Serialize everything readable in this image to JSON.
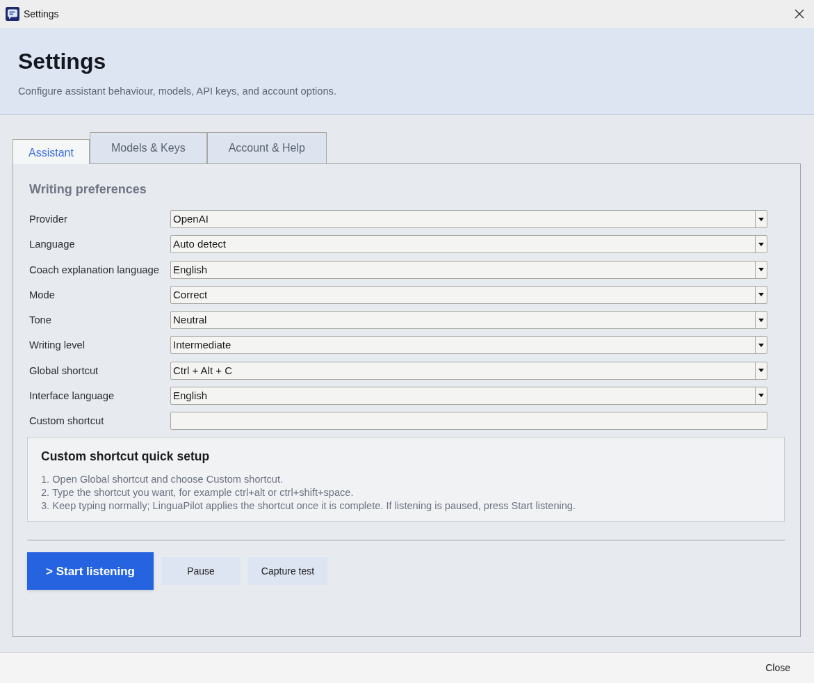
{
  "window": {
    "title": "Settings"
  },
  "header": {
    "title": "Settings",
    "subtitle": "Configure assistant behaviour, models, API keys, and account options."
  },
  "tabs": [
    {
      "label": "Assistant",
      "selected": true
    },
    {
      "label": "Models & Keys",
      "selected": false
    },
    {
      "label": "Account & Help",
      "selected": false
    }
  ],
  "section": {
    "title": "Writing preferences",
    "fields": [
      {
        "kind": "dropdown",
        "label": "Provider",
        "value": "OpenAI"
      },
      {
        "kind": "dropdown",
        "label": "Language",
        "value": "Auto detect"
      },
      {
        "kind": "dropdown",
        "label": "Coach explanation language",
        "value": "English"
      },
      {
        "kind": "dropdown",
        "label": "Mode",
        "value": "Correct"
      },
      {
        "kind": "dropdown",
        "label": "Tone",
        "value": "Neutral"
      },
      {
        "kind": "dropdown",
        "label": "Writing level",
        "value": "Intermediate"
      },
      {
        "kind": "dropdown",
        "label": "Global shortcut",
        "value": "Ctrl + Alt + C"
      },
      {
        "kind": "dropdown",
        "label": "Interface language",
        "value": "English"
      },
      {
        "kind": "text",
        "label": "Custom shortcut"
      }
    ]
  },
  "quick_setup": {
    "title": "Custom shortcut quick setup",
    "steps": [
      "1. Open Global shortcut and choose Custom shortcut.",
      "2. Type the shortcut you want, for example ctrl+alt or ctrl+shift+space.",
      "3. Keep typing normally; LinguaPilot applies the shortcut once it is complete. If listening is paused, press Start listening."
    ]
  },
  "actions": [
    {
      "kind": "primary",
      "label": "> Start listening"
    },
    {
      "kind": "secondary",
      "label": "Pause"
    },
    {
      "kind": "secondary",
      "label": "Capture test"
    }
  ],
  "footer": {
    "button": "Close"
  }
}
